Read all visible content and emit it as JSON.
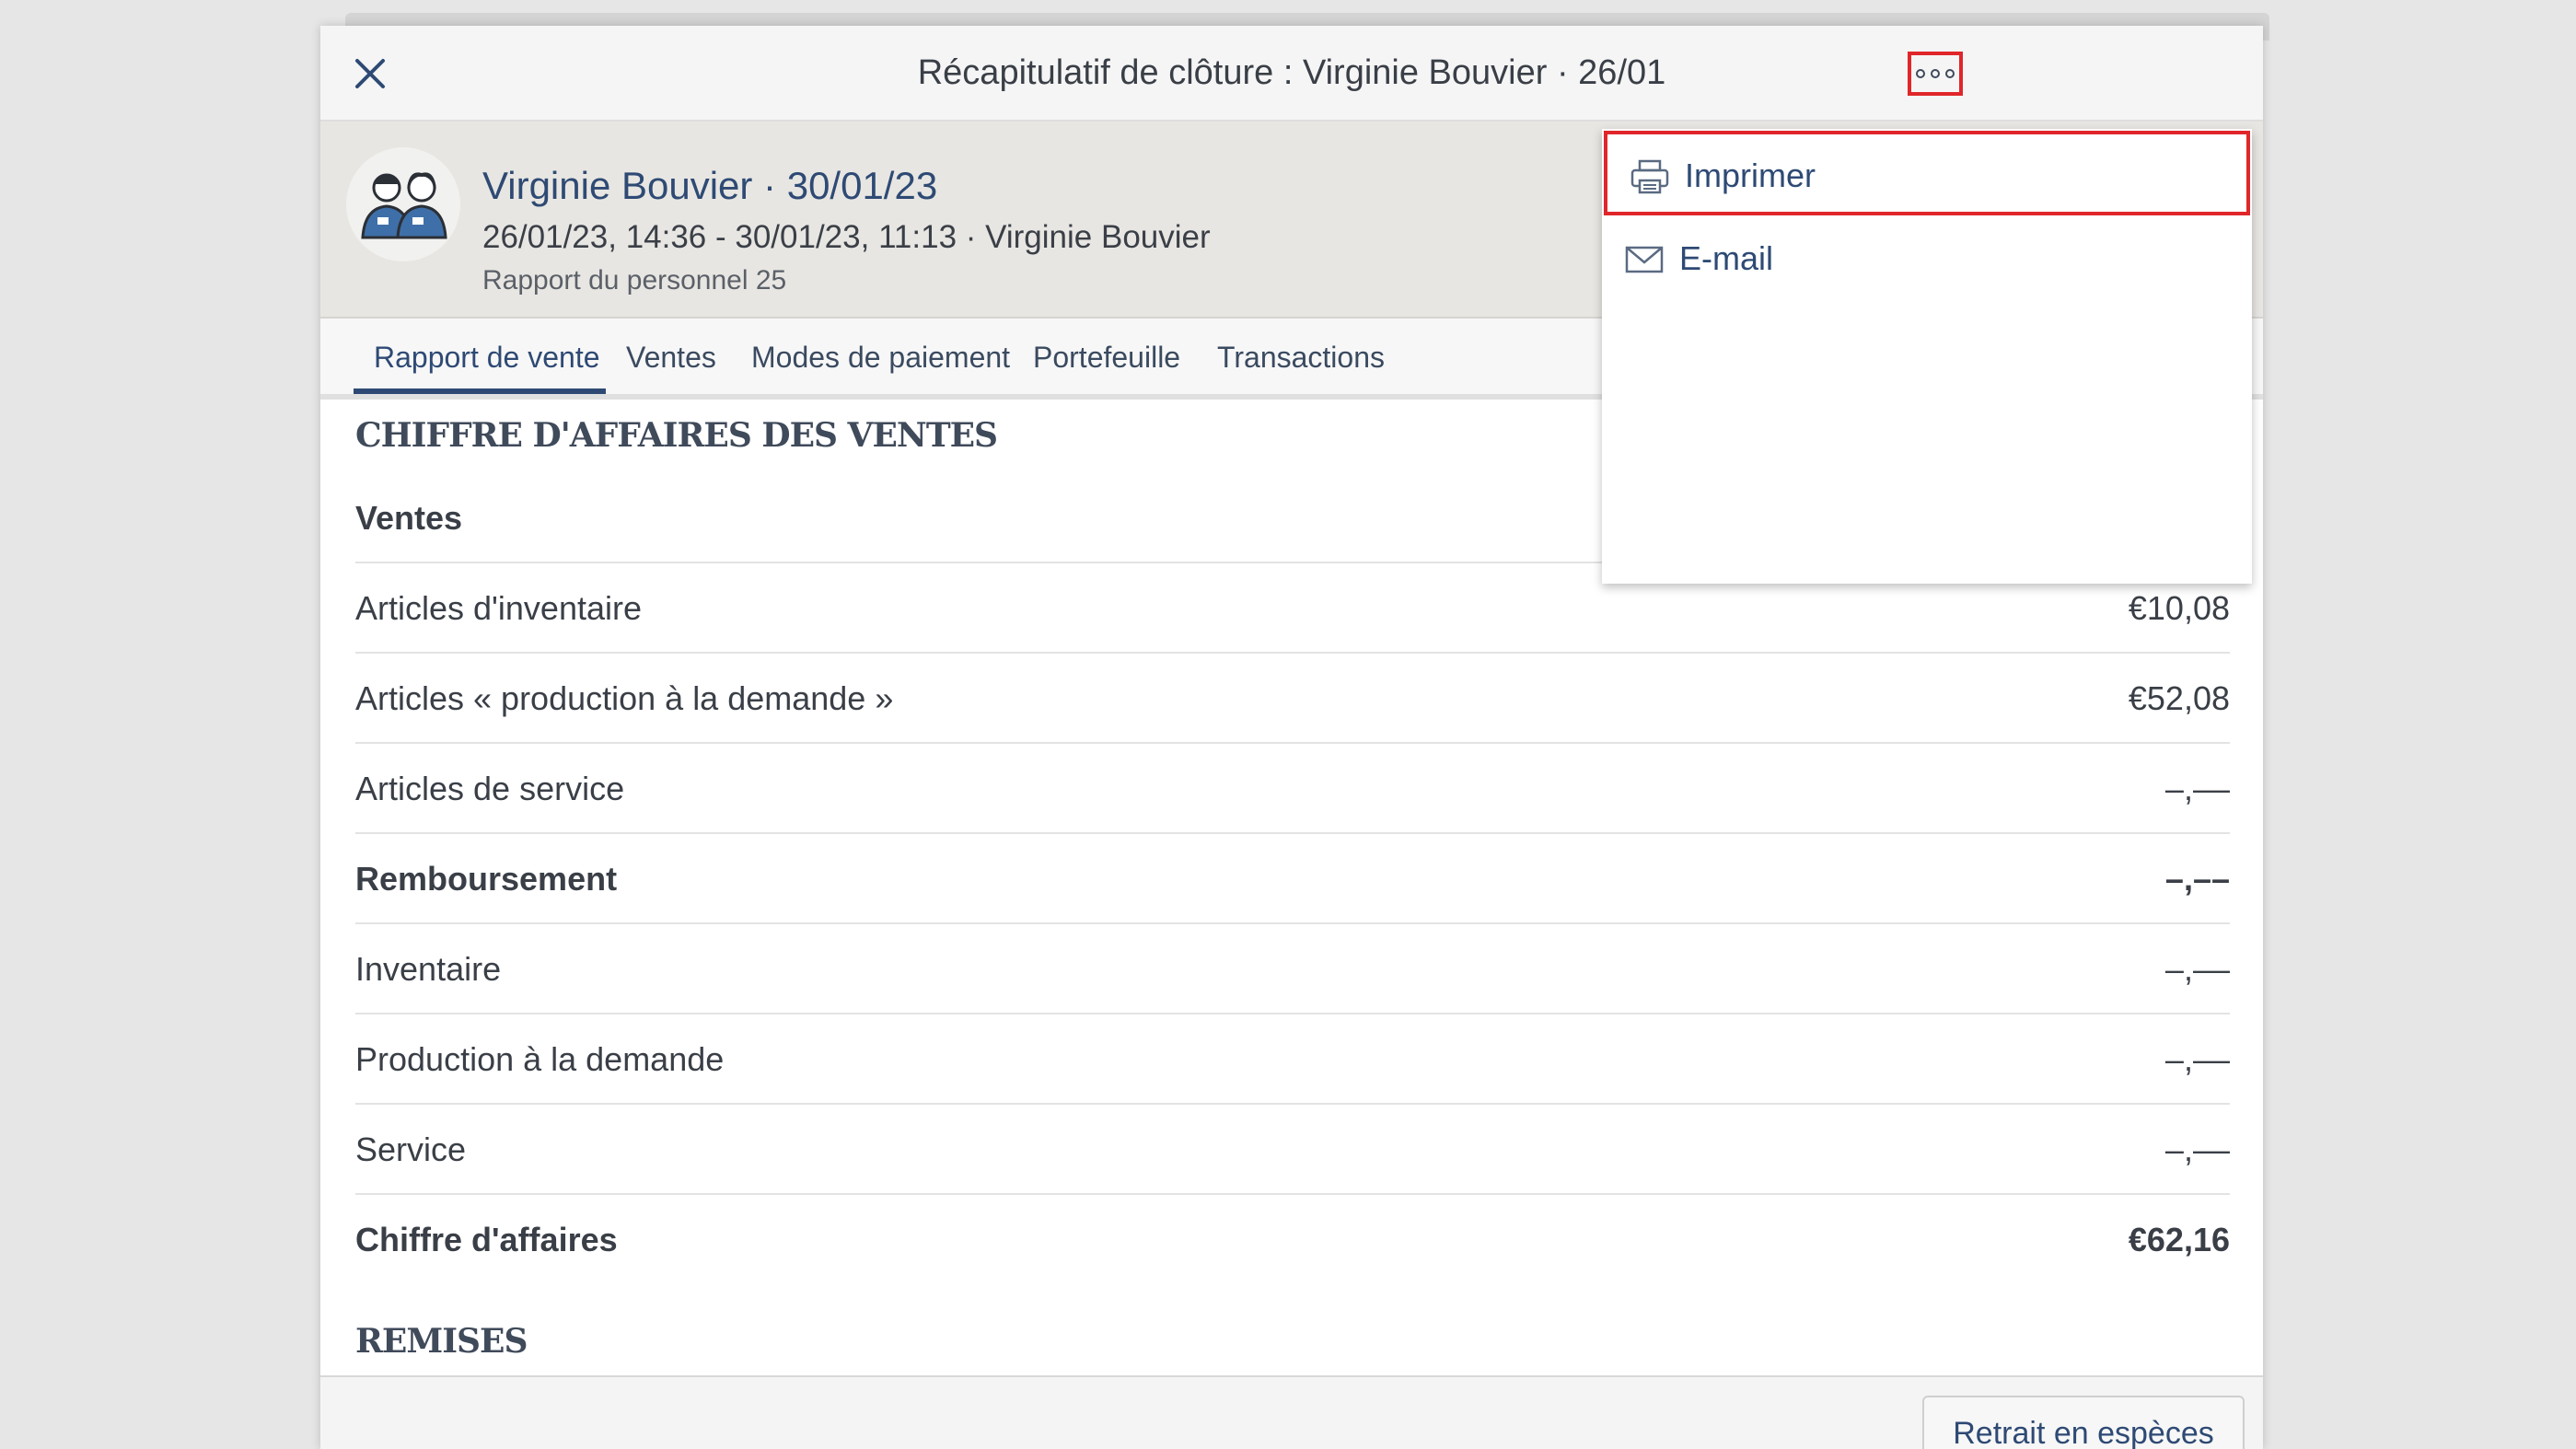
{
  "colors": {
    "accent": "#2e4a74",
    "highlight": "#e0262a"
  },
  "modal": {
    "title": "Récapitulatif de clôture : Virginie Bouvier · 26/01",
    "close_icon": "close-icon",
    "more_icon": "more-options-icon"
  },
  "header": {
    "name": "Virginie Bouvier · 30/01/23",
    "period": "26/01/23, 14:36 - 30/01/23, 11:13 · Virginie Bouvier",
    "report": "Rapport du personnel 25",
    "avatar_icon": "staff-avatar-icon"
  },
  "tabs": [
    {
      "label": "Rapport de vente",
      "active": true
    },
    {
      "label": "Ventes"
    },
    {
      "label": "Modes de paiement"
    },
    {
      "label": "Portefeuille"
    },
    {
      "label": "Transactions"
    }
  ],
  "sections": {
    "sales_revenue": "CHIFFRE D'AFFAIRES DES VENTES",
    "discounts": "REMISES"
  },
  "rows": [
    {
      "label": "Ventes",
      "value": "",
      "bold": true
    },
    {
      "label": "Articles d'inventaire",
      "value": "€10,08"
    },
    {
      "label": "Articles « production à la demande »",
      "value": "€52,08"
    },
    {
      "label": "Articles de service",
      "value": "–,––"
    },
    {
      "label": "Remboursement",
      "value": "–,––",
      "bold": true
    },
    {
      "label": "Inventaire",
      "value": "–,––"
    },
    {
      "label": "Production à la demande",
      "value": "–,––"
    },
    {
      "label": "Service",
      "value": "–,––"
    },
    {
      "label": "Chiffre d'affaires",
      "value": "€62,16",
      "bold": true
    }
  ],
  "footer": {
    "cash_withdrawal": "Retrait en espèces"
  },
  "menu": {
    "items": [
      {
        "label": "Imprimer",
        "icon": "printer-icon"
      },
      {
        "label": "E-mail",
        "icon": "mail-icon"
      }
    ]
  }
}
